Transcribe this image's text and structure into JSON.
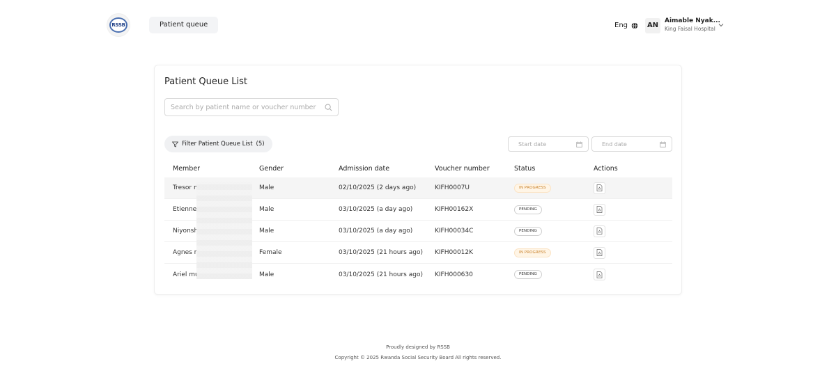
{
  "header": {
    "logo_text": "RSSB",
    "nav": {
      "patient_queue_label": "Patient queue"
    },
    "language": "Eng",
    "user": {
      "initials": "AN",
      "name": "Aimable Nyak...",
      "hospital": "King Faisal Hospital"
    }
  },
  "main": {
    "title": "Patient Queue List",
    "search": {
      "placeholder": "Search by patient name or voucher number"
    },
    "filter": {
      "label": "Filter Patient Queue List",
      "count": "(5)"
    },
    "start_date": {
      "placeholder": "Start date"
    },
    "end_date": {
      "placeholder": "End date"
    },
    "table": {
      "columns": [
        "Member",
        "Gender",
        "Admission date",
        "Voucher number",
        "Status",
        "Actions"
      ],
      "rows": [
        {
          "member": "Tresor m",
          "gender": "Male",
          "admission": "02/10/2025 (2 days ago)",
          "voucher": "KIFH0007U",
          "status": "IN PROGRESS",
          "status_type": "progress"
        },
        {
          "member": "Etienne",
          "gender": "Male",
          "admission": "03/10/2025 (a day ago)",
          "voucher": "KIFH00162X",
          "status": "PENDING",
          "status_type": "pending"
        },
        {
          "member": "Niyonsh",
          "gender": "Male",
          "admission": "03/10/2025 (a day ago)",
          "voucher": "KIFH00034C",
          "status": "PENDING",
          "status_type": "pending"
        },
        {
          "member": "Agnes m",
          "gender": "Female",
          "admission": "03/10/2025 (21 hours ago)",
          "voucher": "KIFH00012K",
          "status": "IN PROGRESS",
          "status_type": "progress"
        },
        {
          "member": "Ariel mu",
          "gender": "Male",
          "admission": "03/10/2025 (21 hours ago)",
          "voucher": "KIFH000630",
          "status": "PENDING",
          "status_type": "pending"
        }
      ]
    }
  },
  "footer": {
    "line1": "Proudly designed by RSSB",
    "line2": "Copyright © 2025 Rwanda Social Security Board All rights reserved."
  },
  "colors": {
    "in_progress_text": "#c9822b",
    "in_progress_bg": "#fff5e6",
    "row_highlight": "#f5f5f5"
  },
  "icons": [
    "globe-icon",
    "chevron-down-icon",
    "search-icon",
    "filter-icon",
    "calendar-icon",
    "pdf-file-icon"
  ]
}
